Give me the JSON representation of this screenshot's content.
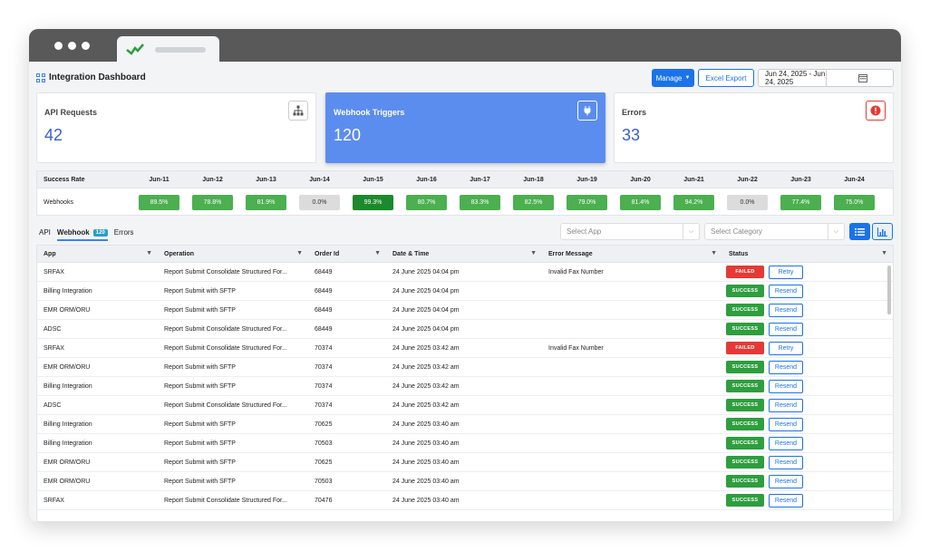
{
  "header": {
    "title": "Integration Dashboard",
    "manage_label": "Manage",
    "export_label": "Excel Export",
    "date_range": "Jun 24, 2025 - Jun 24, 2025"
  },
  "cards": [
    {
      "title": "API Requests",
      "value": "42",
      "icon": "sitemap-icon"
    },
    {
      "title": "Webhook Triggers",
      "value": "120",
      "icon": "plug-icon"
    },
    {
      "title": "Errors",
      "value": "33",
      "icon": "alert-icon"
    }
  ],
  "success_rate": {
    "label": "Success Rate",
    "row_label": "Webhooks",
    "dates": [
      "Jun-11",
      "Jun-12",
      "Jun-13",
      "Jun-14",
      "Jun-15",
      "Jun-16",
      "Jun-17",
      "Jun-18",
      "Jun-19",
      "Jun-20",
      "Jun-21",
      "Jun-22",
      "Jun-23",
      "Jun-24"
    ],
    "values": [
      "89.5%",
      "78.8%",
      "81.9%",
      "0.0%",
      "99.3%",
      "80.7%",
      "83.3%",
      "82.5%",
      "79.0%",
      "81.4%",
      "94.2%",
      "0.0%",
      "77.4%",
      "75.0%"
    ]
  },
  "filters": {
    "tab_api": "API",
    "tab_webhook": "Webhook",
    "webhook_count": "120",
    "tab_errors": "Errors",
    "select_app": "Select App",
    "select_category": "Select Category"
  },
  "table": {
    "columns": [
      "App",
      "Operation",
      "Order Id",
      "Date & Time",
      "Error Message",
      "Status"
    ],
    "rows": [
      {
        "app": "SRFAX",
        "operation": "Report Submit Consolidate Structured For...",
        "order_id": "68449",
        "datetime": "24 June 2025 04:04 pm",
        "error": "Invalid Fax Number",
        "status": "FAILED",
        "action": "Retry"
      },
      {
        "app": "Billing Integration",
        "operation": "Report Submit with SFTP",
        "order_id": "68449",
        "datetime": "24 June 2025 04:04 pm",
        "error": "",
        "status": "SUCCESS",
        "action": "Resend"
      },
      {
        "app": "EMR ORM/ORU",
        "operation": "Report Submit with SFTP",
        "order_id": "68449",
        "datetime": "24 June 2025 04:04 pm",
        "error": "",
        "status": "SUCCESS",
        "action": "Resend"
      },
      {
        "app": "ADSC",
        "operation": "Report Submit Consolidate Structured For...",
        "order_id": "68449",
        "datetime": "24 June 2025 04:04 pm",
        "error": "",
        "status": "SUCCESS",
        "action": "Resend"
      },
      {
        "app": "SRFAX",
        "operation": "Report Submit Consolidate Structured For...",
        "order_id": "70374",
        "datetime": "24 June 2025 03:42 am",
        "error": "Invalid Fax Number",
        "status": "FAILED",
        "action": "Retry"
      },
      {
        "app": "EMR ORM/ORU",
        "operation": "Report Submit with SFTP",
        "order_id": "70374",
        "datetime": "24 June 2025 03:42 am",
        "error": "",
        "status": "SUCCESS",
        "action": "Resend"
      },
      {
        "app": "Billing Integration",
        "operation": "Report Submit with SFTP",
        "order_id": "70374",
        "datetime": "24 June 2025 03:42 am",
        "error": "",
        "status": "SUCCESS",
        "action": "Resend"
      },
      {
        "app": "ADSC",
        "operation": "Report Submit Consolidate Structured For...",
        "order_id": "70374",
        "datetime": "24 June 2025 03:42 am",
        "error": "",
        "status": "SUCCESS",
        "action": "Resend"
      },
      {
        "app": "Billing Integration",
        "operation": "Report Submit with SFTP",
        "order_id": "70625",
        "datetime": "24 June 2025 03:40 am",
        "error": "",
        "status": "SUCCESS",
        "action": "Resend"
      },
      {
        "app": "Billing Integration",
        "operation": "Report Submit with SFTP",
        "order_id": "70503",
        "datetime": "24 June 2025 03:40 am",
        "error": "",
        "status": "SUCCESS",
        "action": "Resend"
      },
      {
        "app": "EMR ORM/ORU",
        "operation": "Report Submit with SFTP",
        "order_id": "70625",
        "datetime": "24 June 2025 03:40 am",
        "error": "",
        "status": "SUCCESS",
        "action": "Resend"
      },
      {
        "app": "EMR ORM/ORU",
        "operation": "Report Submit with SFTP",
        "order_id": "70503",
        "datetime": "24 June 2025 03:40 am",
        "error": "",
        "status": "SUCCESS",
        "action": "Resend"
      },
      {
        "app": "SRFAX",
        "operation": "Report Submit Consolidate Structured For...",
        "order_id": "70476",
        "datetime": "24 June 2025 03:40 am",
        "error": "",
        "status": "SUCCESS",
        "action": "Resend"
      }
    ]
  },
  "colors": {
    "primary": "#1a73e8",
    "card_active": "#5b8def",
    "success": "#2e9e3e",
    "failed": "#e53935"
  }
}
